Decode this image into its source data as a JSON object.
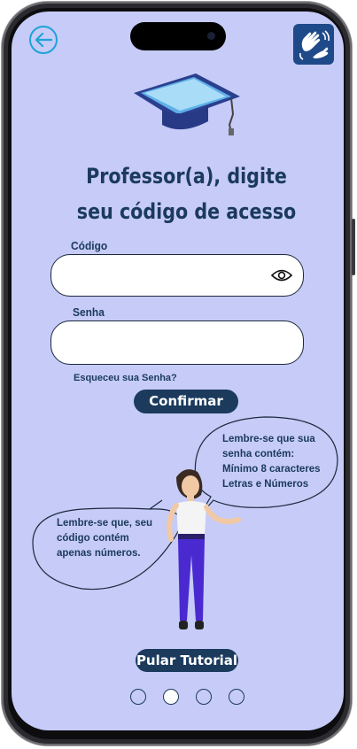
{
  "header": {
    "back_icon": "arrow-left-icon",
    "libras_icon": "sign-language-icon"
  },
  "title": "Professor(a), digite seu código de acesso",
  "form": {
    "code_label": "Código",
    "code_value": "",
    "password_label": "Senha",
    "password_value": "",
    "toggle_icon": "eye-icon",
    "forgot_link": "Esqueceu sua Senha?",
    "confirm_button": "Confirmar"
  },
  "tutorial": {
    "bubble_password": "Lembre-se que sua\nsenha contém:\nMínimo 8 caracteres\nLetras e Números",
    "bubble_code": "Lembre-se que, seu\ncódigo  contém\napenas números.",
    "skip_button": "Pular Tutorial",
    "pages": 4,
    "current_page": 2
  },
  "colors": {
    "background": "#c6cbf7",
    "primary": "#1b3a5c",
    "accent": "#1fa3d6"
  }
}
